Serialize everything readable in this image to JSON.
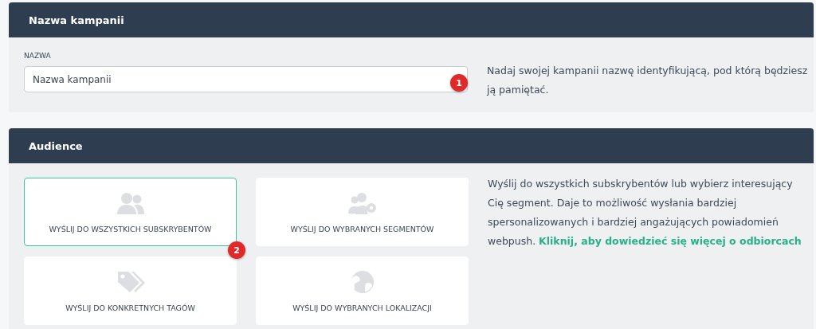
{
  "name_panel": {
    "title": "Nazwa kampanii",
    "field_label": "NAZWA",
    "field_value": "Nazwa kampanii",
    "badge": "1",
    "description": "Nadaj swojej kampanii nazwę identyfikującą, pod którą będziesz ją pamiętać."
  },
  "audience_panel": {
    "title": "Audience",
    "badge": "2",
    "options": [
      {
        "label": "WYŚLIJ DO WSZYSTKICH SUBSKRYBENTÓW",
        "kind": "users",
        "selected": true
      },
      {
        "label": "WYŚLIJ DO WYBRANYCH SEGMENTÓW",
        "kind": "users-gear",
        "selected": false
      },
      {
        "label": "WYŚLIJ DO KONKRETNYCH TAGÓW",
        "kind": "tags",
        "selected": false
      },
      {
        "label": "WYŚLIJ DO WYBRANYCH LOKALIZACJI",
        "kind": "globe",
        "selected": false
      }
    ],
    "description": "Wyślij do wszystkich subskrybentów lub wybierz interesujący Cię segment. Daje to możliwość wysłania bardziej spersonalizowanych i bardziej angażujących powiadomień webpush.",
    "link": "Kliknij, aby dowiedzieć się więcej o odbiorcach"
  }
}
